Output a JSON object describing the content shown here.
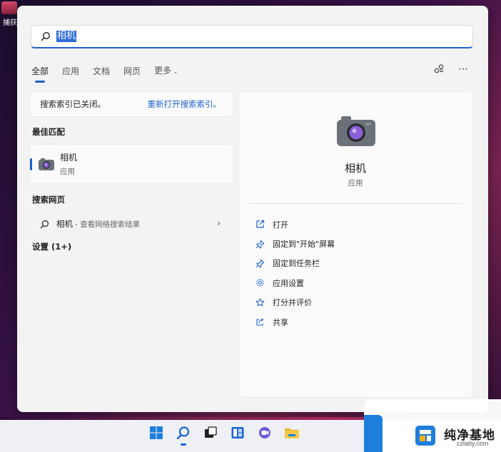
{
  "desktop": {
    "icon_label": "捕获"
  },
  "search": {
    "query": "相机"
  },
  "tabs": [
    {
      "label": "全部"
    },
    {
      "label": "应用"
    },
    {
      "label": "文档"
    },
    {
      "label": "网页"
    },
    {
      "label": "更多"
    }
  ],
  "notice": {
    "message": "搜索索引已关闭。",
    "link": "重新打开搜索索引。"
  },
  "best_match": {
    "section_title": "最佳匹配",
    "name": "相机",
    "type": "应用"
  },
  "web_search": {
    "section_title": "搜索网页",
    "query": "相机",
    "hint": "- 查看网络搜索结果"
  },
  "settings_section": {
    "title": "设置 (1+)"
  },
  "detail": {
    "name": "相机",
    "type": "应用",
    "actions": [
      {
        "label": "打开",
        "icon": "open-icon"
      },
      {
        "label": "固定到\"开始\"屏幕",
        "icon": "pin-icon"
      },
      {
        "label": "固定到任务栏",
        "icon": "pin-icon"
      },
      {
        "label": "应用设置",
        "icon": "gear-icon"
      },
      {
        "label": "打分并评价",
        "icon": "star-icon"
      },
      {
        "label": "共享",
        "icon": "share-icon"
      }
    ]
  },
  "watermark": {
    "brand": "纯净基地",
    "domain": "czlaby.com"
  },
  "colors": {
    "accent": "#1d62d0",
    "panel": "#f3f3f3",
    "card": "#fbfbfb"
  }
}
